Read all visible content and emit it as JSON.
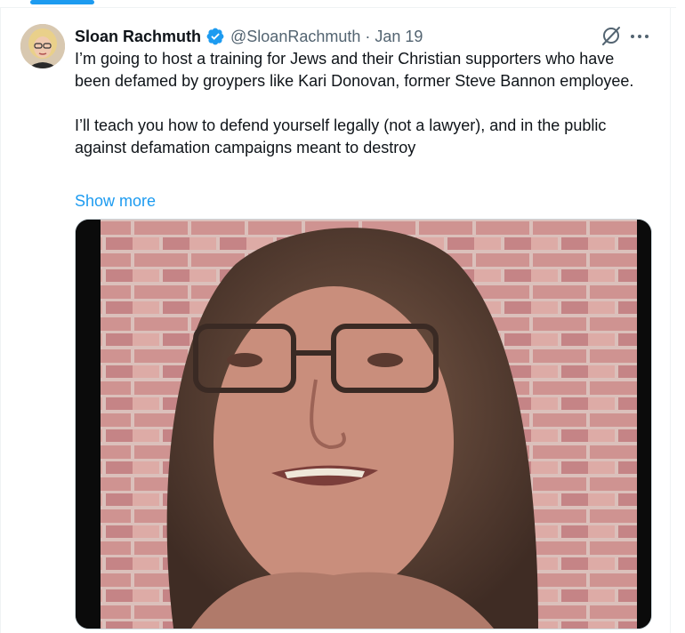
{
  "tweet": {
    "author_name": "Sloan Rachmuth",
    "handle": "@SloanRachmuth",
    "separator": "·",
    "date": "Jan 19",
    "text_paragraph_1": "I’m going to host a training for Jews and their Christian supporters who have been defamed by groypers like Kari Donovan, former Steve Bannon employee.",
    "text_paragraph_2": "I’ll teach you how to defend yourself legally (not a lawyer), and in the public against defamation campaigns meant to destroy",
    "show_more_label": "Show more"
  },
  "icons": {
    "verified": "verified-badge-icon",
    "grok": "grok-icon",
    "more": "more-icon"
  },
  "colors": {
    "accent": "#1d9bf0",
    "text_primary": "#0f1419",
    "text_secondary": "#536471",
    "border": "#eff3f4"
  }
}
